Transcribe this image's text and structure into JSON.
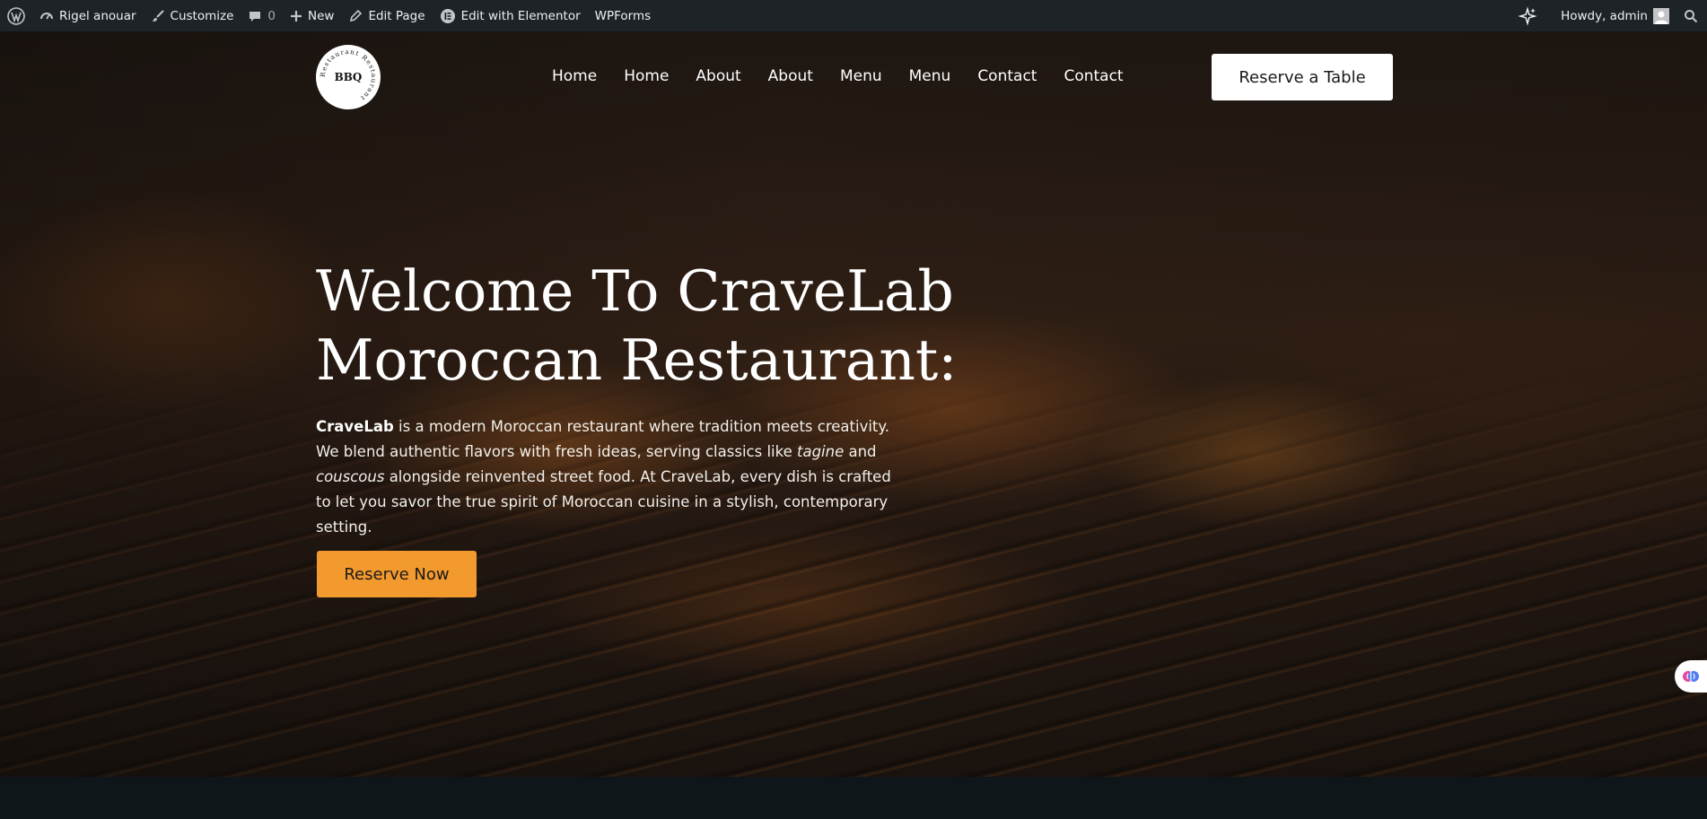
{
  "admin_bar": {
    "site_name": "Rigel anouar",
    "customize": "Customize",
    "comments_count": "0",
    "new": "New",
    "edit_page": "Edit Page",
    "edit_elementor": "Edit with Elementor",
    "wpforms": "WPForms",
    "howdy": "Howdy, admin"
  },
  "header": {
    "logo": {
      "center_text": "BBQ",
      "ring_text": "Restaurant Restaurant"
    },
    "nav": [
      "Home",
      "Home",
      "About",
      "About",
      "Menu",
      "Menu",
      "Contact",
      "Contact"
    ],
    "cta": "Reserve a Table"
  },
  "hero": {
    "title_line1": "Welcome To CraveLab",
    "title_line2": "Moroccan Restaurant:",
    "body": {
      "brand": "CraveLab",
      "part1": " is a modern Moroccan restaurant where tradition meets creativity. We blend authentic flavors with fresh ideas, serving classics like ",
      "dish1": "tagine",
      "and": " and ",
      "dish2": "couscous",
      "part2": " alongside reinvented street food. At CraveLab, every dish is crafted to let you savor the true spirit of Moroccan cuisine in a stylish, contemporary setting."
    },
    "button": "Reserve Now"
  },
  "colors": {
    "admin_bar_bg": "#1d2327",
    "accent_orange": "#f39a2e",
    "white": "#ffffff"
  },
  "icons": {
    "wordpress": "wordpress-logo-icon",
    "dashboard": "dashboard-icon",
    "customize": "paintbrush-icon",
    "comments": "comment-bubble-icon",
    "new": "plus-icon",
    "edit": "pencil-icon",
    "elementor": "elementor-icon",
    "ai": "sparkles-icon",
    "avatar": "avatar-icon",
    "search": "search-icon",
    "widget": "brain-icon"
  }
}
